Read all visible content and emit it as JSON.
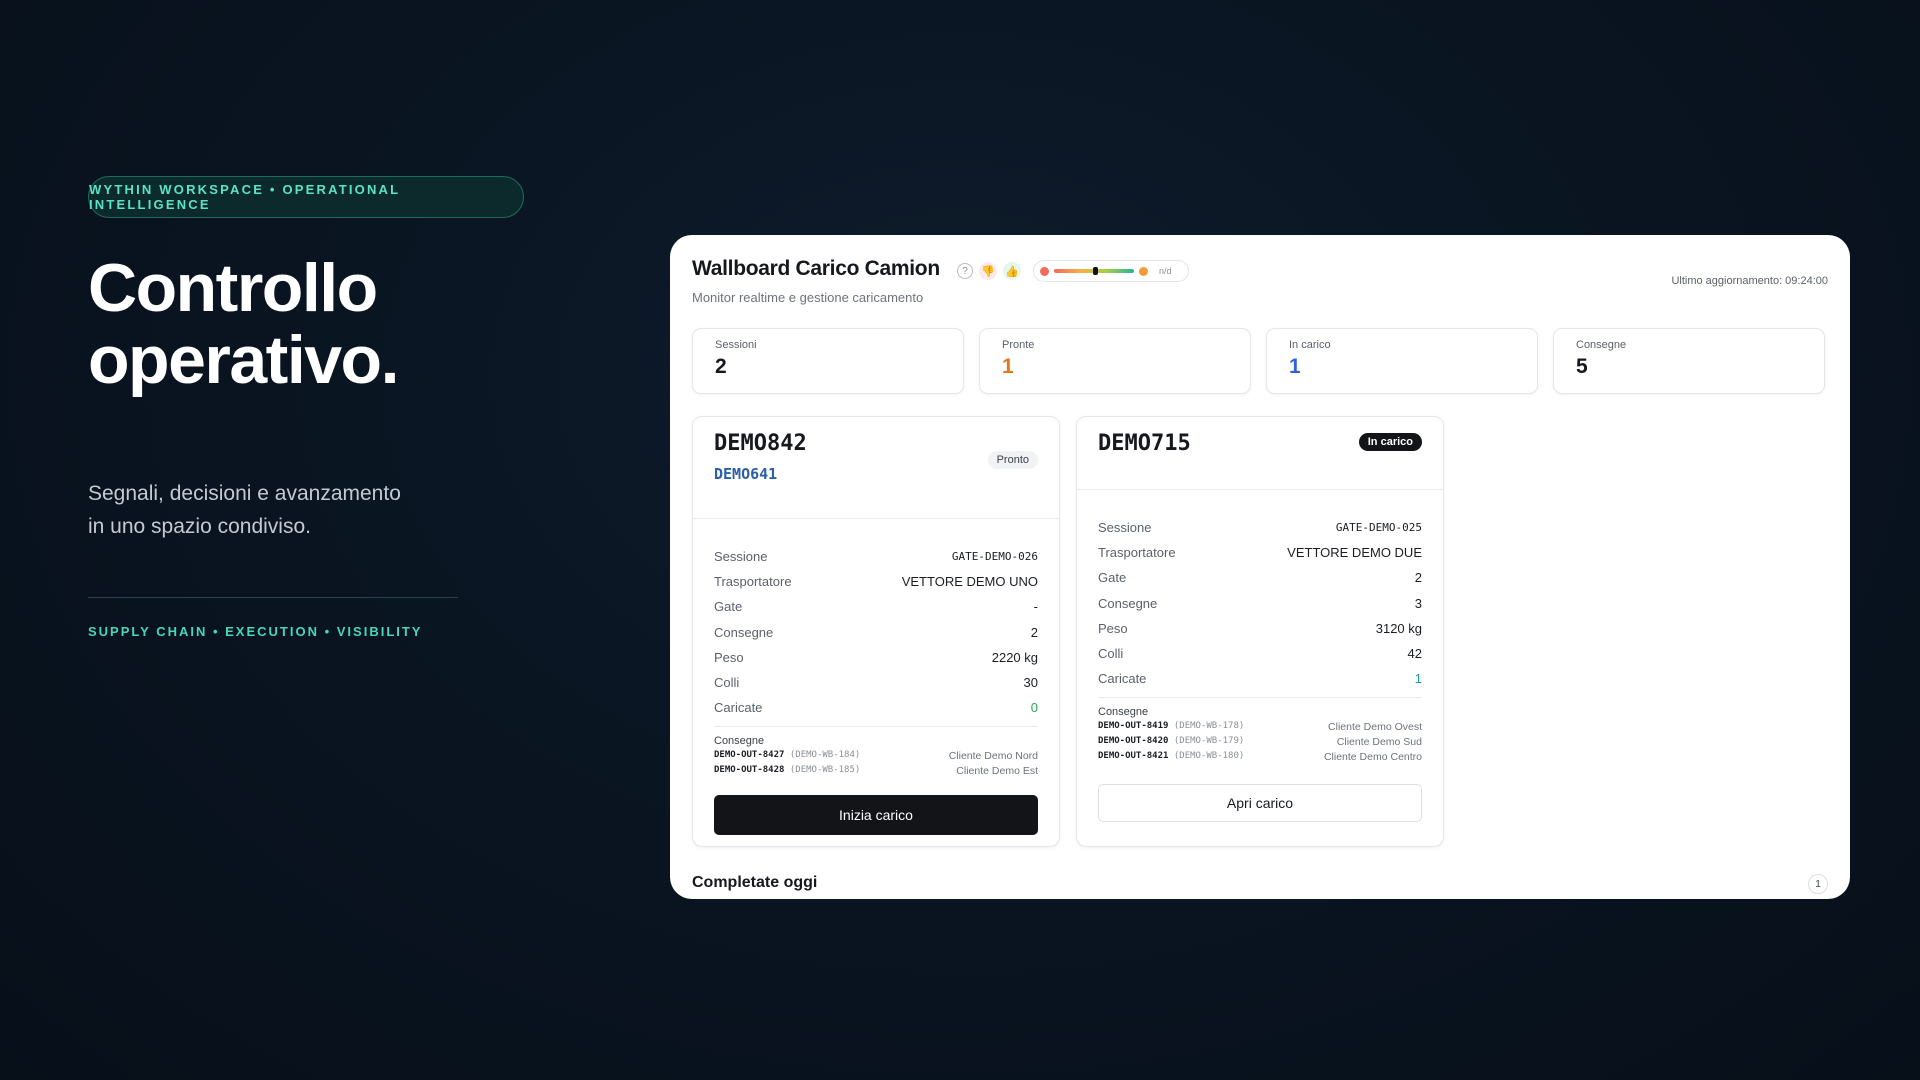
{
  "hero": {
    "badge": "WYTHIN WORKSPACE • OPERATIONAL INTELLIGENCE",
    "title": "Controllo\noperativo.",
    "subtitle": "Segnali, decisioni e avanzamento\nin uno spazio condiviso.",
    "tags": "SUPPLY CHAIN • EXECUTION • VISIBILITY"
  },
  "panel": {
    "title": "Wallboard Carico Camion",
    "subtitle": "Monitor realtime e gestione caricamento",
    "help_glyph": "?",
    "thumbs_down_glyph": "👎",
    "thumbs_up_glyph": "👍",
    "scale_na": "n/d",
    "updated": "Ultimo aggiornamento: 09:24:00",
    "stats": [
      {
        "label": "Sessioni",
        "value": "2",
        "color": "#15181d"
      },
      {
        "label": "Pronte",
        "value": "1",
        "color": "#e07a1f"
      },
      {
        "label": "In carico",
        "value": "1",
        "color": "#2f63d6"
      },
      {
        "label": "Consegne",
        "value": "5",
        "color": "#15181d"
      }
    ],
    "cards": [
      {
        "id": "DEMO842",
        "code": "DEMO641",
        "badge": "Pronto",
        "rows": [
          {
            "k": "Sessione",
            "v": "GATE-DEMO-026"
          },
          {
            "k": "Trasportatore",
            "v": "VETTORE DEMO UNO"
          },
          {
            "k": "Gate",
            "v": "-"
          },
          {
            "k": "Consegne",
            "v": "2"
          },
          {
            "k": "Peso",
            "v": "2220 kg"
          },
          {
            "k": "Colli",
            "v": "30"
          },
          {
            "k": "Caricate",
            "v": "0"
          }
        ],
        "deliveries_title": "Consegne",
        "deliveries": [
          {
            "id": "DEMO-OUT-8427",
            "ref": "(DEMO-WB-184)",
            "client": "Cliente Demo Nord"
          },
          {
            "id": "DEMO-OUT-8428",
            "ref": "(DEMO-WB-185)",
            "client": "Cliente Demo Est"
          }
        ],
        "action": "Inizia carico"
      },
      {
        "id": "DEMO715",
        "badge": "In carico",
        "rows": [
          {
            "k": "Sessione",
            "v": "GATE-DEMO-025"
          },
          {
            "k": "Trasportatore",
            "v": "VETTORE DEMO DUE"
          },
          {
            "k": "Gate",
            "v": "2"
          },
          {
            "k": "Consegne",
            "v": "3"
          },
          {
            "k": "Peso",
            "v": "3120 kg"
          },
          {
            "k": "Colli",
            "v": "42"
          },
          {
            "k": "Caricate",
            "v": "1"
          }
        ],
        "deliveries_title": "Consegne",
        "deliveries": [
          {
            "id": "DEMO-OUT-8419",
            "ref": "(DEMO-WB-178)",
            "client": "Cliente Demo Ovest"
          },
          {
            "id": "DEMO-OUT-8420",
            "ref": "(DEMO-WB-179)",
            "client": "Cliente Demo Sud"
          },
          {
            "id": "DEMO-OUT-8421",
            "ref": "(DEMO-WB-180)",
            "client": "Cliente Demo Centro"
          }
        ],
        "action": "Apri carico"
      }
    ],
    "completed_title": "Completate oggi",
    "completed_count": "1"
  }
}
